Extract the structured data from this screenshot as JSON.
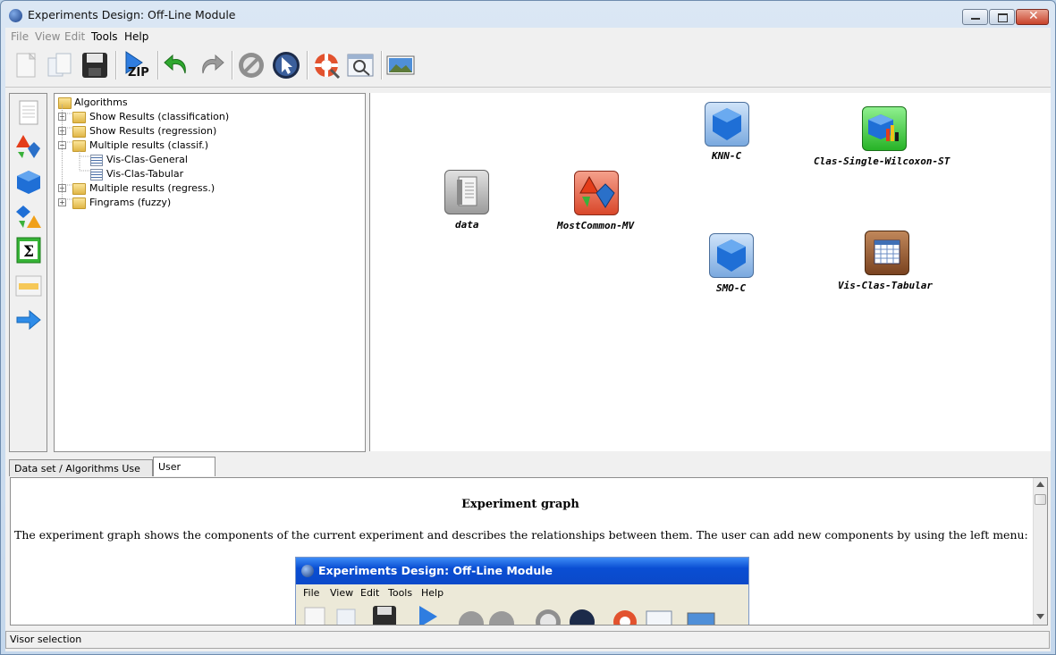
{
  "window": {
    "title": "Experiments Design: Off-Line Module"
  },
  "menu": {
    "items": [
      {
        "label": "File",
        "enabled": false
      },
      {
        "label": "View",
        "enabled": false
      },
      {
        "label": "Edit",
        "enabled": false
      },
      {
        "label": "Tools",
        "enabled": true
      },
      {
        "label": "Help",
        "enabled": true
      }
    ]
  },
  "toolbar": {
    "zip_label": "ZIP"
  },
  "tree": {
    "root": "Algorithms",
    "items": [
      {
        "label": "Show Results (classification)",
        "expanded": false
      },
      {
        "label": "Show Results (regression)",
        "expanded": false
      },
      {
        "label": "Multiple results (classif.)",
        "expanded": true
      },
      {
        "label": "Vis-Clas-General"
      },
      {
        "label": "Vis-Clas-Tabular"
      },
      {
        "label": "Multiple results (regress.)",
        "expanded": false
      },
      {
        "label": "Fingrams (fuzzy)",
        "expanded": false
      }
    ]
  },
  "graph": {
    "nodes": [
      {
        "label": "data",
        "icon": "dataset-icon"
      },
      {
        "label": "MostCommon-MV",
        "icon": "preprocess-icon"
      },
      {
        "label": "KNN-C",
        "icon": "method-cube-icon"
      },
      {
        "label": "SMO-C",
        "icon": "method-cube-icon"
      },
      {
        "label": "Clas-Single-Wilcoxon-ST",
        "icon": "statistical-test-icon"
      },
      {
        "label": "Vis-Clas-Tabular",
        "icon": "visualization-table-icon"
      }
    ]
  },
  "tabs": [
    {
      "label": "Data set / Algorithms Use Case",
      "active": false
    },
    {
      "label": "User Manual",
      "active": true
    }
  ],
  "manual": {
    "heading": "Experiment graph",
    "paragraph": "The experiment graph shows the components of the current experiment and describes the relationships between them. The user can add new components by using the left menu:",
    "embedded_screenshot": {
      "title": "Experiments Design: Off-Line Module",
      "menu": [
        "File",
        "View",
        "Edit",
        "Tools",
        "Help"
      ]
    }
  },
  "status": {
    "text": "Visor selection"
  },
  "colors": {
    "title_bar": "#c4d7ec",
    "xp_title": "#0a4ed3",
    "close_button": "#c8432b"
  }
}
